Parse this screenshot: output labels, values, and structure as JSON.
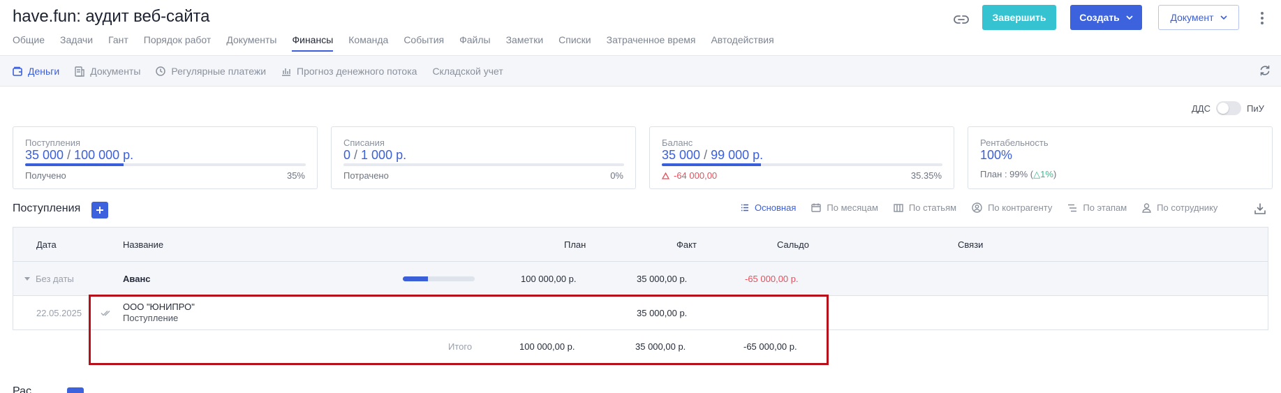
{
  "header": {
    "title": "have.fun: аудит веб-сайта",
    "tabs": [
      "Общие",
      "Задачи",
      "Гант",
      "Порядок работ",
      "Документы",
      "Финансы",
      "Команда",
      "События",
      "Файлы",
      "Заметки",
      "Списки",
      "Затраченное время",
      "Автодействия"
    ],
    "active_tab": "Финансы",
    "finish_label": "Завершить",
    "create_label": "Создать",
    "document_label": "Документ"
  },
  "subnav": {
    "items": [
      "Деньги",
      "Документы",
      "Регулярные платежи",
      "Прогноз денежного потока",
      "Складской учет"
    ],
    "active": "Деньги"
  },
  "toggle": {
    "left_label": "ДДС",
    "right_label": "ПиУ",
    "state": "ДДС"
  },
  "cards": {
    "income": {
      "label": "Поступления",
      "value": "35 000",
      "slash": " / ",
      "total": "100 000 р.",
      "sub": "Получено",
      "pct": "35%",
      "progress": 0.35
    },
    "expense": {
      "label": "Списания",
      "value": "0",
      "slash": " / ",
      "total": "1 000 р.",
      "sub": "Потрачено",
      "pct": "0%",
      "progress": 0
    },
    "balance": {
      "label": "Баланс",
      "value": "35 000",
      "slash": " / ",
      "total": "99 000 р.",
      "sub": "-64 000,00",
      "pct": "35.35%",
      "progress": 0.3535
    },
    "profit": {
      "label": "Рентабельность",
      "value": "100%",
      "sub_prefix": "План : 99% (",
      "sub_delta": "1%",
      "sub_suffix": ")"
    }
  },
  "section": {
    "title": "Поступления",
    "views": [
      "Основная",
      "По месяцам",
      "По статьям",
      "По контрагенту",
      "По этапам",
      "По сотруднику"
    ],
    "active_view": "Основная"
  },
  "table": {
    "columns": {
      "date": "Дата",
      "name": "Название",
      "plan": "План",
      "fact": "Факт",
      "saldo": "Сальдо",
      "links": "Связи"
    },
    "group": {
      "date": "Без даты",
      "name": "Аванс",
      "plan": "100 000,00 р.",
      "fact": "35 000,00 р.",
      "saldo": "-65 000,00 р.",
      "progress": 0.35
    },
    "rows": [
      {
        "date": "22.05.2025",
        "name": "ООО \"ЮНИПРО\"",
        "type": "Поступление",
        "fact": "35 000,00 р."
      }
    ],
    "totals": {
      "label": "Итого",
      "plan": "100 000,00 р.",
      "fact": "35 000,00 р.",
      "saldo": "-65 000,00 р."
    }
  },
  "next_section": {
    "title": "Рас"
  },
  "colors": {
    "accent": "#3b5fd9",
    "teal": "#35c3d1",
    "red": "#e4505c",
    "green": "#3cb88c",
    "highlight": "#b8101a"
  }
}
